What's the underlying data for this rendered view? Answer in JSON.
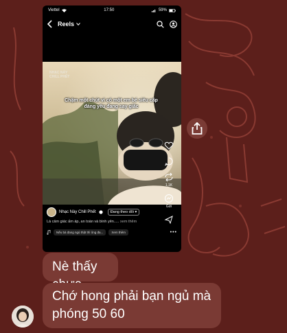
{
  "status_bar": {
    "carrier": "Viettel",
    "time": "17:50",
    "battery": "59%"
  },
  "reels_header": {
    "title": "Reels",
    "dropdown_icon": "chevron-down-icon",
    "back_icon": "back-arrow-icon",
    "search_icon": "search-icon",
    "profile_icon": "profile-circle-icon"
  },
  "video": {
    "brand_line1": "NHẠC NÀY",
    "brand_line2": "CHILL PHẾT",
    "subtitle": "Chậm một chút vì có một em bé siêu cấp đáng yêu đang say giấc"
  },
  "side_actions": {
    "like_count": "",
    "comment_count": "",
    "share_count": "1,1K",
    "meta_label": "Gửi"
  },
  "post": {
    "channel_name": "Nhạc Này Chill Phết",
    "follow_label": "Đang theo dõi",
    "caption": "Là cảm giác ấm áp, an toàn và bình yên.....",
    "caption_more": "xem thêm",
    "music_text": "Nếu bà đang ngủ thật thì ông đa...",
    "music_more": "Xem thêm"
  },
  "messages": [
    {
      "text": "Nè thấy chưa"
    },
    {
      "text": "Chớ hong phải bạn ngủ mà phóng 50 60"
    }
  ],
  "colors": {
    "background": "#5c1f1b",
    "bubble": "#7a3a34",
    "doodle": "#8a3a32"
  }
}
